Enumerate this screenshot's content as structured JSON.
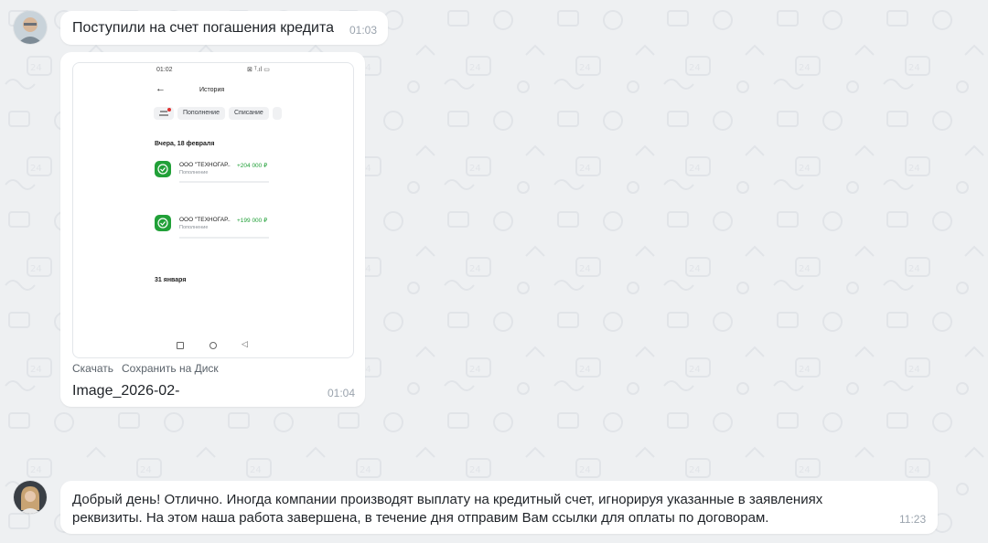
{
  "colors": {
    "background": "#eef0f2",
    "bubble": "#ffffff",
    "accent_green": "#21a038",
    "amount_green": "#21a038"
  },
  "messages": [
    {
      "text": "Поступили на счет погашения кредита",
      "time": "01:03"
    },
    {
      "screenshot": {
        "status_time": "01:02",
        "screen_title": "История",
        "filters": [
          "Пополнение",
          "Списание"
        ],
        "date_header_1": "Вчера, 18 февраля",
        "transactions": [
          {
            "name": "ООО \"ТЕХНОГАР..",
            "type": "Пополнение",
            "amount": "+204 000 ₽"
          },
          {
            "name": "ООО \"ТЕХНОГАР..",
            "type": "Пополнение",
            "amount": "+199 000 ₽"
          }
        ],
        "date_header_2": "31 января"
      },
      "download_label": "Скачать",
      "save_disk_label": "Сохранить на Диск",
      "file_name": "Image_2026-02-",
      "time": "01:04"
    },
    {
      "text_line1": "Добрый день! Отлично. Иногда компании производят выплату на кредитный счет, игнорируя указанные в заявлениях",
      "text_line2": "реквизиты. На этом наша работа завершена, в течение дня отправим Вам ссылки для оплаты по договорам.",
      "time": "11:23"
    }
  ]
}
